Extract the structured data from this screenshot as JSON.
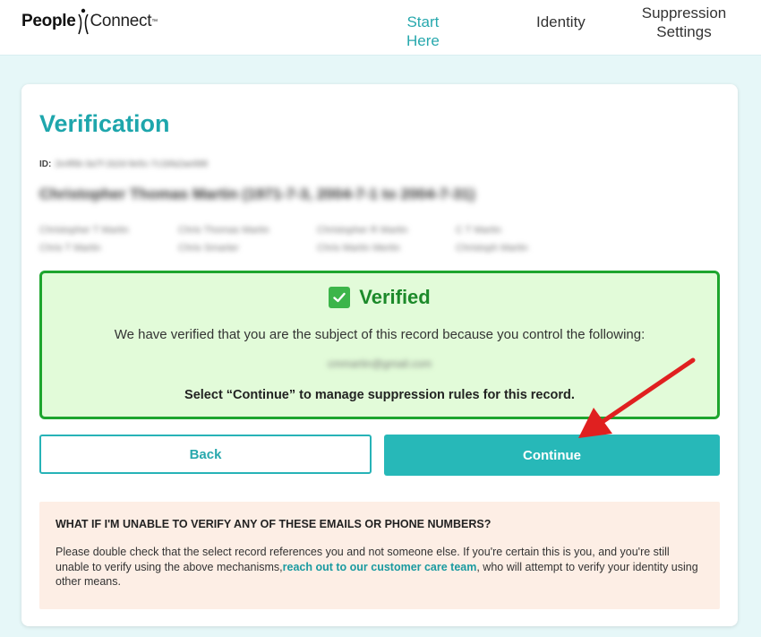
{
  "brand": {
    "name_left": "People",
    "name_right": "Connect",
    "trademark": "™"
  },
  "nav": {
    "start_here": "Start Here",
    "identity": "Identity",
    "suppression_line1": "Suppression",
    "suppression_line2": "Settings"
  },
  "page": {
    "title": "Verification",
    "id_label": "ID:",
    "id_value": "2e4f6b-3a7f-1b2d-9e5c-7c1bfa2ae688",
    "record_name": "Christopher Thomas Martin (1971-7-3, 2004-7-1 to 2004-7-31)",
    "aliases": [
      [
        "Christopher T Martin",
        "Chris Thomas Martin",
        "Christopher R Martin",
        "C T Martin"
      ],
      [
        "Chris T Martin",
        "Chris Smarter",
        "Chris Martin Mertin",
        "Christoph Martin"
      ]
    ]
  },
  "verified": {
    "title": "Verified",
    "message": "We have verified that you are the subject of this record because you control the following:",
    "contact": "cmmartin@gmail.com",
    "instruction": "Select “Continue” to manage suppression rules for this record."
  },
  "buttons": {
    "back": "Back",
    "continue": "Continue"
  },
  "help": {
    "title": "WHAT IF I'M UNABLE TO VERIFY ANY OF THESE EMAILS OR PHONE NUMBERS?",
    "text_before": "Please double check that the select record references you and not someone else. If you're certain this is you, and you're still unable to verify using the above mechanisms,",
    "link": "reach out to our customer care team",
    "text_after": ", who will attempt to verify your identity using other means."
  },
  "colors": {
    "accent": "#27b8b8",
    "verified_border": "#1ea52e",
    "verified_bg": "#e2fbd9",
    "help_bg": "#fdeee5",
    "annotation_arrow": "#e02020"
  }
}
